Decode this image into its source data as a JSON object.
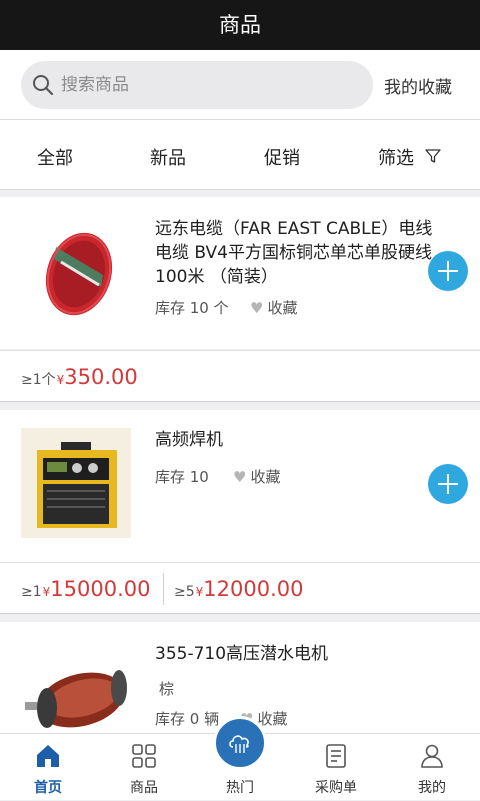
{
  "header": {
    "title": "商品"
  },
  "search": {
    "placeholder": "搜索商品",
    "favorites_label": "我的收藏"
  },
  "tabs": [
    {
      "label": "全部"
    },
    {
      "label": "新品"
    },
    {
      "label": "促销"
    },
    {
      "label": "筛选",
      "icon": "filter-icon"
    }
  ],
  "products": [
    {
      "title": "远东电缆（FAR EAST CABLE）电线电缆 BV4平方国标铜芯单芯单股硬线100米 （简装）",
      "stock": "库存 10 个",
      "fav_label": "收藏",
      "prices": [
        {
          "qty": "≥1个",
          "currency": "¥",
          "amount": "350.00"
        }
      ]
    },
    {
      "title": "高频焊机",
      "stock": "库存 10",
      "fav_label": "收藏",
      "prices": [
        {
          "qty": "≥1",
          "currency": "¥",
          "amount": "15000.00"
        },
        {
          "qty": "≥5",
          "currency": "¥",
          "amount": "12000.00"
        }
      ]
    },
    {
      "title": "355-710高压潜水电机",
      "spec": "棕",
      "stock": "库存 0 辆",
      "fav_label": "收藏"
    }
  ],
  "tabbar": [
    {
      "label": "首页",
      "icon": "home-icon",
      "active": true
    },
    {
      "label": "商品",
      "icon": "grid-icon"
    },
    {
      "label": "热门",
      "icon": "cloud-icon"
    },
    {
      "label": "采购单",
      "icon": "order-icon"
    },
    {
      "label": "我的",
      "icon": "user-icon"
    }
  ],
  "colors": {
    "accent": "#2fa7df",
    "price": "#d23a3a",
    "active_tab": "#1c5fa8",
    "topbar": "#161616"
  }
}
